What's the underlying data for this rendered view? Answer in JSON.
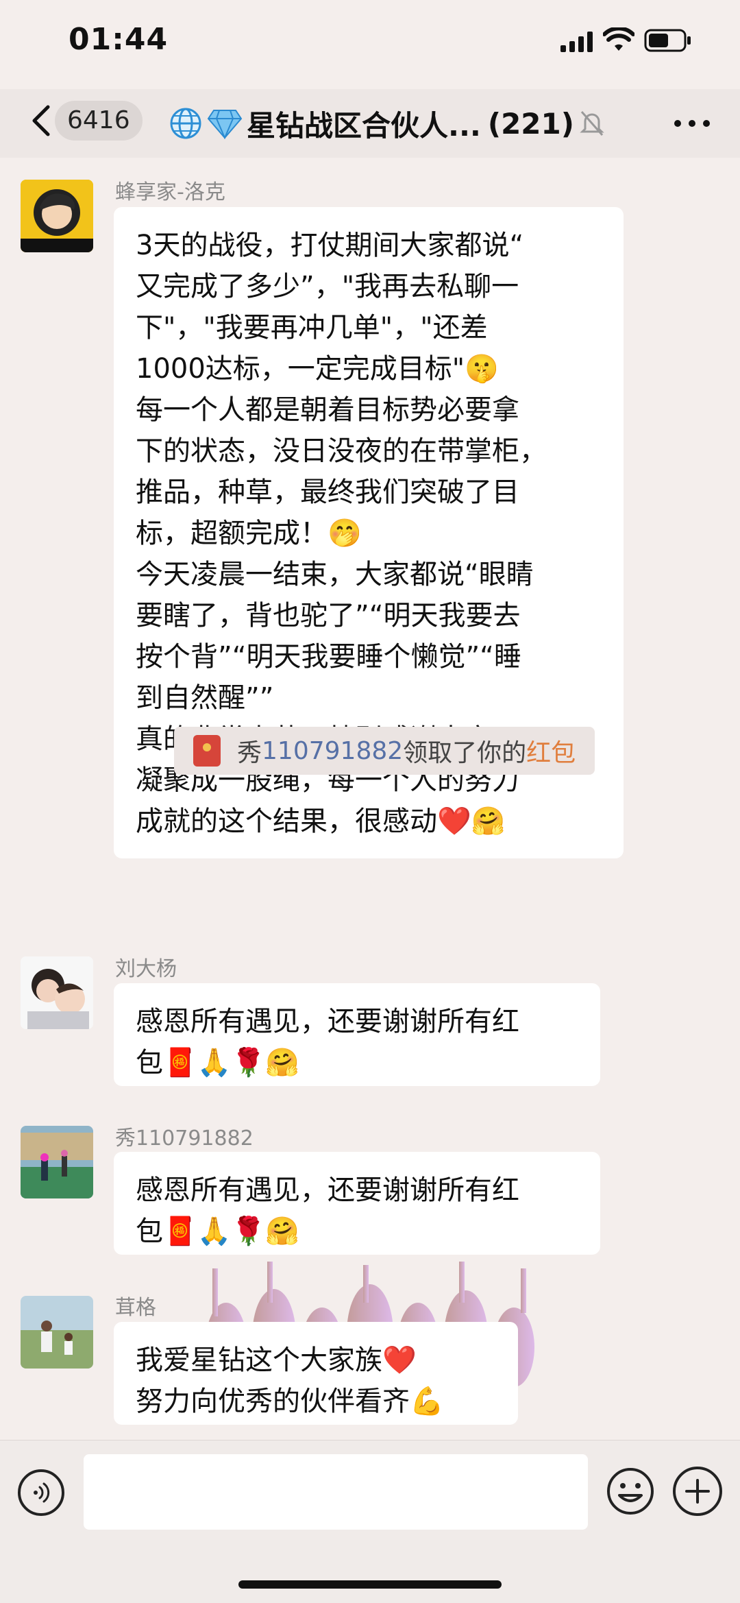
{
  "status_bar": {
    "time": "01:44"
  },
  "nav": {
    "unread_count": "6416",
    "group_title": "星钻战区合伙人...",
    "member_count": "(221)",
    "title_icons": [
      "globe-icon",
      "diamond-icon"
    ],
    "mute_icon": "bell-muted-icon"
  },
  "messages": [
    {
      "sender": "蜂享家-洛克",
      "lines": [
        "3天的战役，打仗期间大家都说“",
        "又完成了多少”，\"我再去私聊一",
        "下\"，\"我要再冲几单\"，\"还差",
        "1000达标，一定完成目标\"🤫",
        "每一个人都是朝着目标势必要拿",
        "下的状态，没日没夜的在带掌柜，",
        "推品，种草，最终我们突破了目",
        "标，超额完成！🤭",
        "今天凌晨一结束，大家都说“眼睛",
        "要瞎了，背也驼了”“明天我要去",
        "按个背”“明天我要睡个懒觉”“睡",
        "到自然醒””",
        "真的非常幸苦，特别感谢大家，",
        "凝聚成一股绳，每一个人的努力",
        "成就的这个结果，很感动❤️🤗"
      ]
    },
    {
      "sender": "刘大杨",
      "lines": [
        "感恩所有遇见，还要谢谢所有红",
        "包🧧🙏🌹🤗"
      ]
    },
    {
      "sender": "秀110791882",
      "lines": [
        "感恩所有遇见，还要谢谢所有红",
        "包🧧🙏🌹🤗"
      ]
    },
    {
      "sender": "茸格",
      "lines": [
        "我爱星钻这个大家族❤️",
        "努力向优秀的伙伴看齐💪"
      ]
    }
  ],
  "system_notice": {
    "prefix": "秀",
    "user_id": "110791882",
    "middle": "领取了你的",
    "link": "红包",
    "icon": "red-packet-icon"
  },
  "input_bar": {
    "voice_icon": "voice-icon",
    "emoji_icon": "emoji-icon",
    "plus_icon": "plus-icon",
    "placeholder": ""
  },
  "colors": {
    "background": "#f4eeec",
    "bubble": "#ffffff",
    "link_blue": "#5670a6",
    "red_packet_orange": "#e07e3d"
  }
}
